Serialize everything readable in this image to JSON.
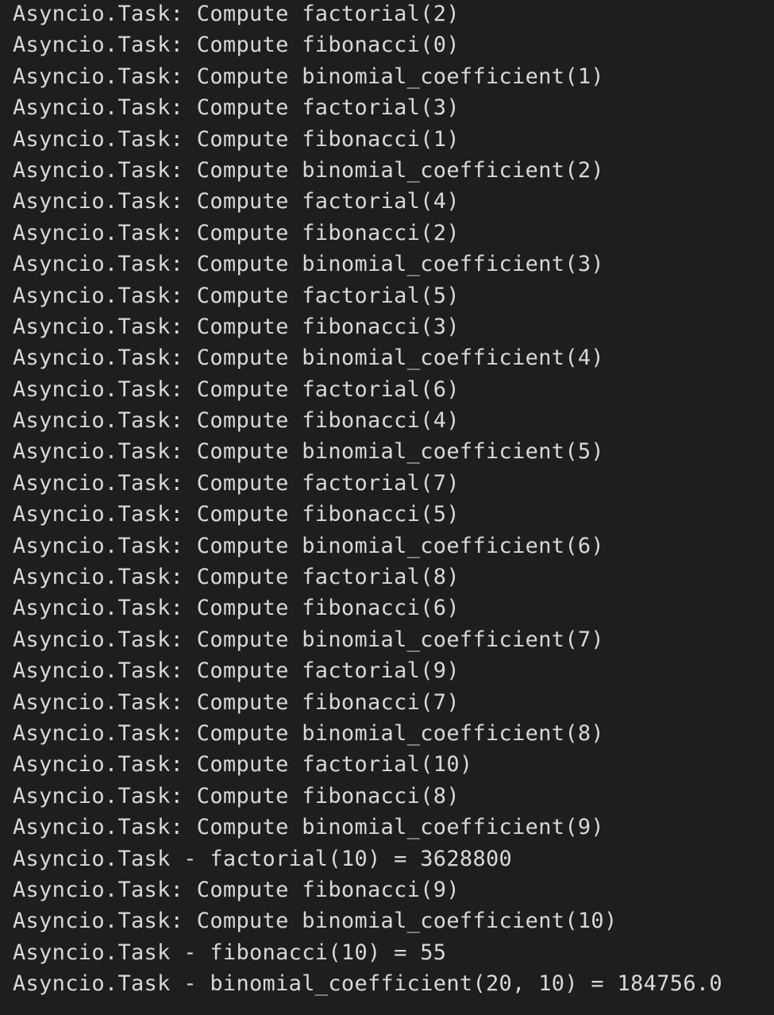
{
  "terminal": {
    "background_color": "#1e1e1e",
    "text_color": "#d8d8d8",
    "lines": [
      "Asyncio.Task: Compute factorial(2)",
      "Asyncio.Task: Compute fibonacci(0)",
      "Asyncio.Task: Compute binomial_coefficient(1)",
      "Asyncio.Task: Compute factorial(3)",
      "Asyncio.Task: Compute fibonacci(1)",
      "Asyncio.Task: Compute binomial_coefficient(2)",
      "Asyncio.Task: Compute factorial(4)",
      "Asyncio.Task: Compute fibonacci(2)",
      "Asyncio.Task: Compute binomial_coefficient(3)",
      "Asyncio.Task: Compute factorial(5)",
      "Asyncio.Task: Compute fibonacci(3)",
      "Asyncio.Task: Compute binomial_coefficient(4)",
      "Asyncio.Task: Compute factorial(6)",
      "Asyncio.Task: Compute fibonacci(4)",
      "Asyncio.Task: Compute binomial_coefficient(5)",
      "Asyncio.Task: Compute factorial(7)",
      "Asyncio.Task: Compute fibonacci(5)",
      "Asyncio.Task: Compute binomial_coefficient(6)",
      "Asyncio.Task: Compute factorial(8)",
      "Asyncio.Task: Compute fibonacci(6)",
      "Asyncio.Task: Compute binomial_coefficient(7)",
      "Asyncio.Task: Compute factorial(9)",
      "Asyncio.Task: Compute fibonacci(7)",
      "Asyncio.Task: Compute binomial_coefficient(8)",
      "Asyncio.Task: Compute factorial(10)",
      "Asyncio.Task: Compute fibonacci(8)",
      "Asyncio.Task: Compute binomial_coefficient(9)",
      "Asyncio.Task - factorial(10) = 3628800",
      "Asyncio.Task: Compute fibonacci(9)",
      "Asyncio.Task: Compute binomial_coefficient(10)",
      "Asyncio.Task - fibonacci(10) = 55",
      "Asyncio.Task - binomial_coefficient(20, 10) = 184756.0"
    ]
  }
}
